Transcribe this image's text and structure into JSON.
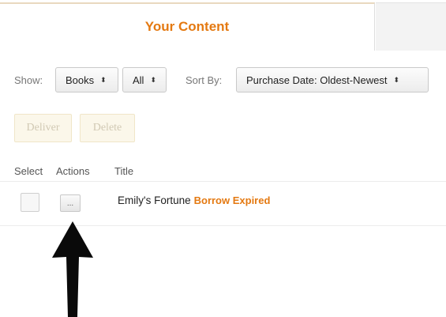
{
  "tabs": {
    "active_label": "Your Content"
  },
  "filters": {
    "show_label": "Show:",
    "type_value": "Books",
    "scope_value": "All",
    "sort_label": "Sort By:",
    "sort_value": "Purchase Date: Oldest-Newest",
    "select_arrows": "⬍"
  },
  "actions": {
    "deliver_label": "Deliver",
    "delete_label": "Delete"
  },
  "table": {
    "headers": [
      "Select",
      "Actions",
      "Title"
    ],
    "rows": [
      {
        "actions_label": "...",
        "title": "Emily's Fortune",
        "status": "Borrow Expired"
      }
    ]
  },
  "icons": {
    "annotation": "black-up-arrow-icon"
  },
  "colors": {
    "accent": "#e47911",
    "disabled_button_bg": "#fbf7ea",
    "disabled_button_text": "#d1c9b4"
  }
}
